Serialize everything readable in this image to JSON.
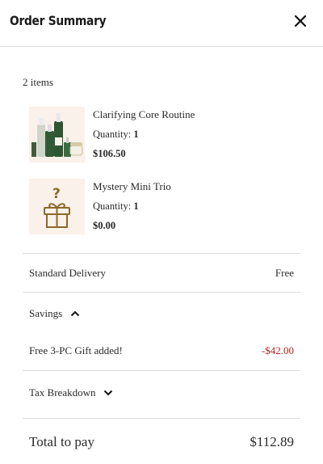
{
  "header": {
    "title": "Order Summary",
    "close_icon": "close-icon"
  },
  "summary": {
    "items_count": "2 items"
  },
  "items": [
    {
      "name": "Clarifying Core Routine",
      "qty_label": "Quantity:",
      "qty": "1",
      "price": "$106.50",
      "thumb_icon": "skincare-bottles-image"
    },
    {
      "name": "Mystery Mini Trio",
      "qty_label": "Quantity:",
      "qty": "1",
      "price": "$0.00",
      "thumb_icon": "mystery-gift-icon"
    }
  ],
  "delivery": {
    "label": "Standard Delivery",
    "value": "Free"
  },
  "savings": {
    "label": "Savings",
    "gift_label": "Free 3-PC Gift added!",
    "gift_value": "-$42.00",
    "chevron_icon": "chevron-up-icon"
  },
  "tax": {
    "label": "Tax Breakdown",
    "chevron_icon": "chevron-down-icon"
  },
  "total": {
    "label": "Total to pay",
    "value": "$112.89"
  },
  "colors": {
    "accent_red": "#b3261e",
    "thumb_bg": "#faf1ea",
    "gift_gold": "#8a6a2a"
  }
}
